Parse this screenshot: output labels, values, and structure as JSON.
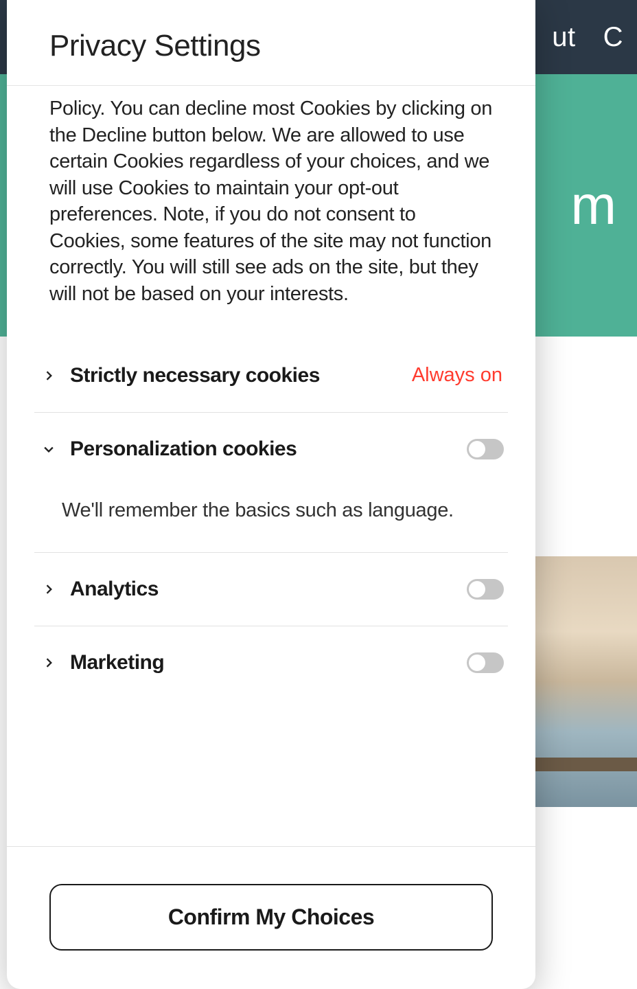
{
  "background": {
    "nav_partial_1": "ut",
    "nav_partial_2": "C",
    "hero_partial": "m"
  },
  "modal": {
    "title": "Privacy Settings",
    "policy_text": "Policy. You can decline most Cookies by clicking on the Decline button below. We are allowed to use certain Cookies regardless of your choices, and we will use Cookies to maintain your opt-out preferences. Note, if you do not consent to Cookies, some features of the site may not function correctly. You will still see ads on the site, but they will not be based on your interests.",
    "categories": [
      {
        "title": "Strictly necessary cookies",
        "always_on_label": "Always on",
        "expanded": false,
        "always_on": true
      },
      {
        "title": "Personalization cookies",
        "expanded": true,
        "toggle": false,
        "description": "We'll remember the basics such as language."
      },
      {
        "title": "Analytics",
        "expanded": false,
        "toggle": false
      },
      {
        "title": "Marketing",
        "expanded": false,
        "toggle": false
      }
    ],
    "confirm_label": "Confirm My Choices"
  }
}
